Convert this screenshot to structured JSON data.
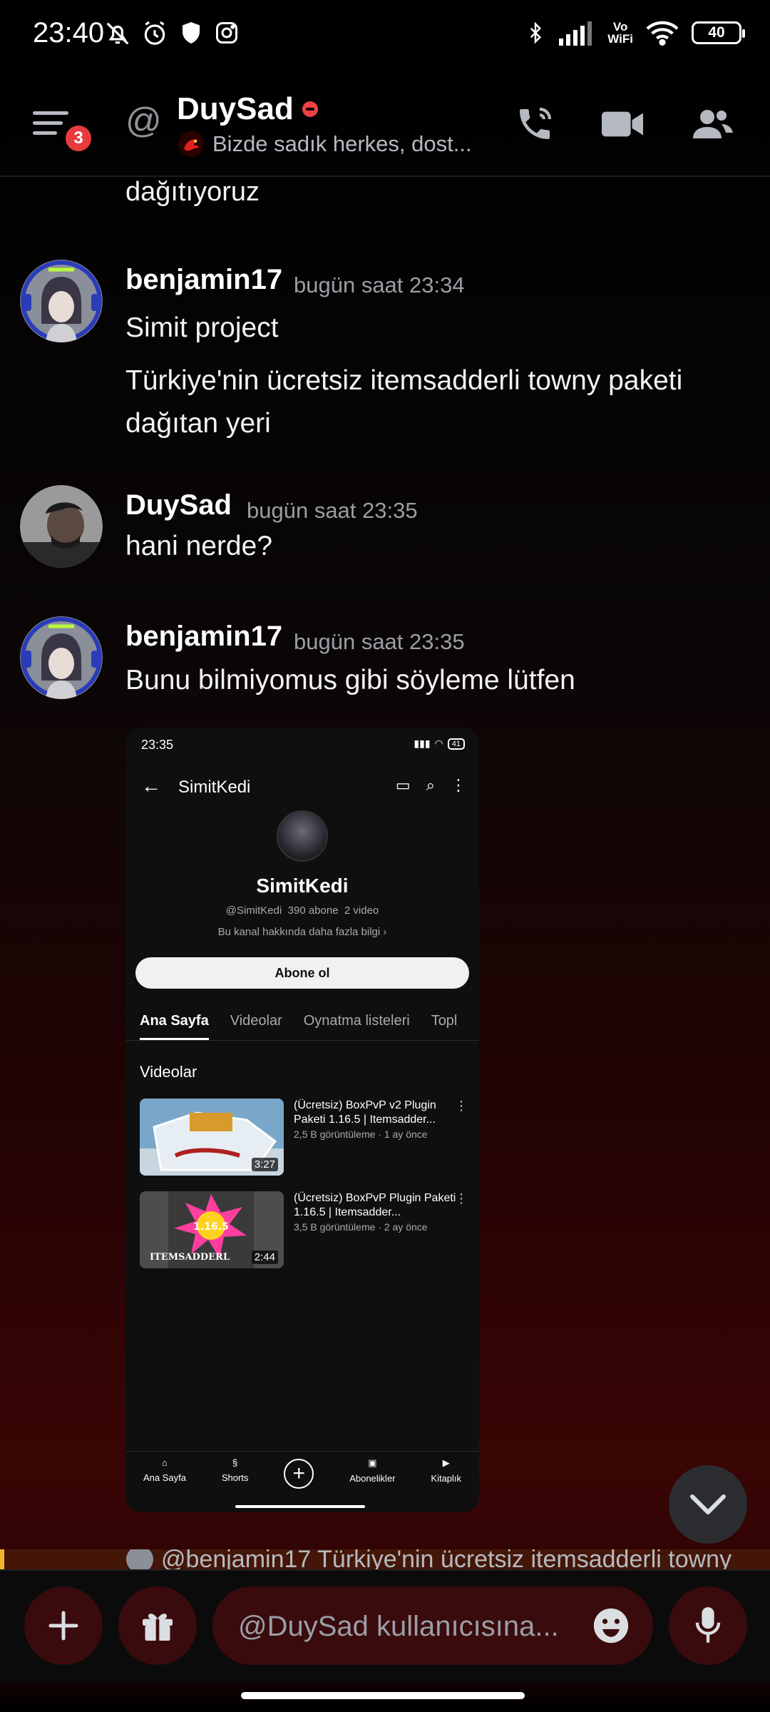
{
  "status_bar": {
    "time": "23:40",
    "icons_left": [
      "bell-muted-icon",
      "alarm-icon",
      "shield-icon",
      "instagram-icon"
    ],
    "icons_right": [
      "bluetooth-icon",
      "signal-icon",
      "vowifi-icon",
      "wifi-icon"
    ],
    "vowifi_top": "Vo",
    "vowifi_bottom": "WiFi",
    "battery": "40"
  },
  "header": {
    "notification_count": "3",
    "name": "DuySad",
    "status_text": "Bizde sadık herkes, dost...",
    "accent": "#ed4245"
  },
  "chat": {
    "top_fragment": "dağıtıyoruz",
    "messages": [
      {
        "author": "benjamin17",
        "time": "bugün saat 23:34",
        "lines": [
          "Simit project",
          "Türkiye'nin ücretsiz itemsadderli towny paketi",
          "dağıtan yeri"
        ]
      },
      {
        "author": "DuySad",
        "time": "bugün saat 23:35",
        "lines": [
          "hani nerde?"
        ]
      },
      {
        "author": "benjamin17",
        "time": "bugün saat 23:35",
        "lines": [
          "Bunu bilmiyomus gibi söyleme lütfen"
        ]
      }
    ]
  },
  "attachment": {
    "status_time": "23:35",
    "battery": "41",
    "channel_name": "SimitKedi",
    "channel_handle": "@SimitKedi",
    "subscribers": "390 abone",
    "videos_count": "2 video",
    "more_info": "Bu kanal hakkında daha fazla bilgi",
    "subscribe_label": "Abone ol",
    "tabs": [
      "Ana Sayfa",
      "Videolar",
      "Oynatma listeleri",
      "Topl"
    ],
    "section_title": "Videolar",
    "videos": [
      {
        "title": "(Ücretsiz) BoxPvP v2 Plugin Paketi 1.16.5 | Itemsadder...",
        "meta": "2,5 B görüntüleme · 1 ay önce",
        "duration": "3:27"
      },
      {
        "title": "(Ücretsiz) BoxPvP Plugin Paketi 1.16.5 | Itemsadder...",
        "meta": "3,5 B görüntüleme · 2 ay önce",
        "duration": "2:44",
        "overlay_text_1": "1.16.5",
        "overlay_text_2": "ITEMSADDERL"
      }
    ],
    "nav": [
      "Ana Sayfa",
      "Shorts",
      "",
      "Abonelikler",
      "Kitaplık"
    ]
  },
  "reply_preview": {
    "text": "@benjamin17  Türkiye'nin ücretsiz itemsadderli towny"
  },
  "composer": {
    "placeholder": "@DuySad kullanıcısına..."
  }
}
